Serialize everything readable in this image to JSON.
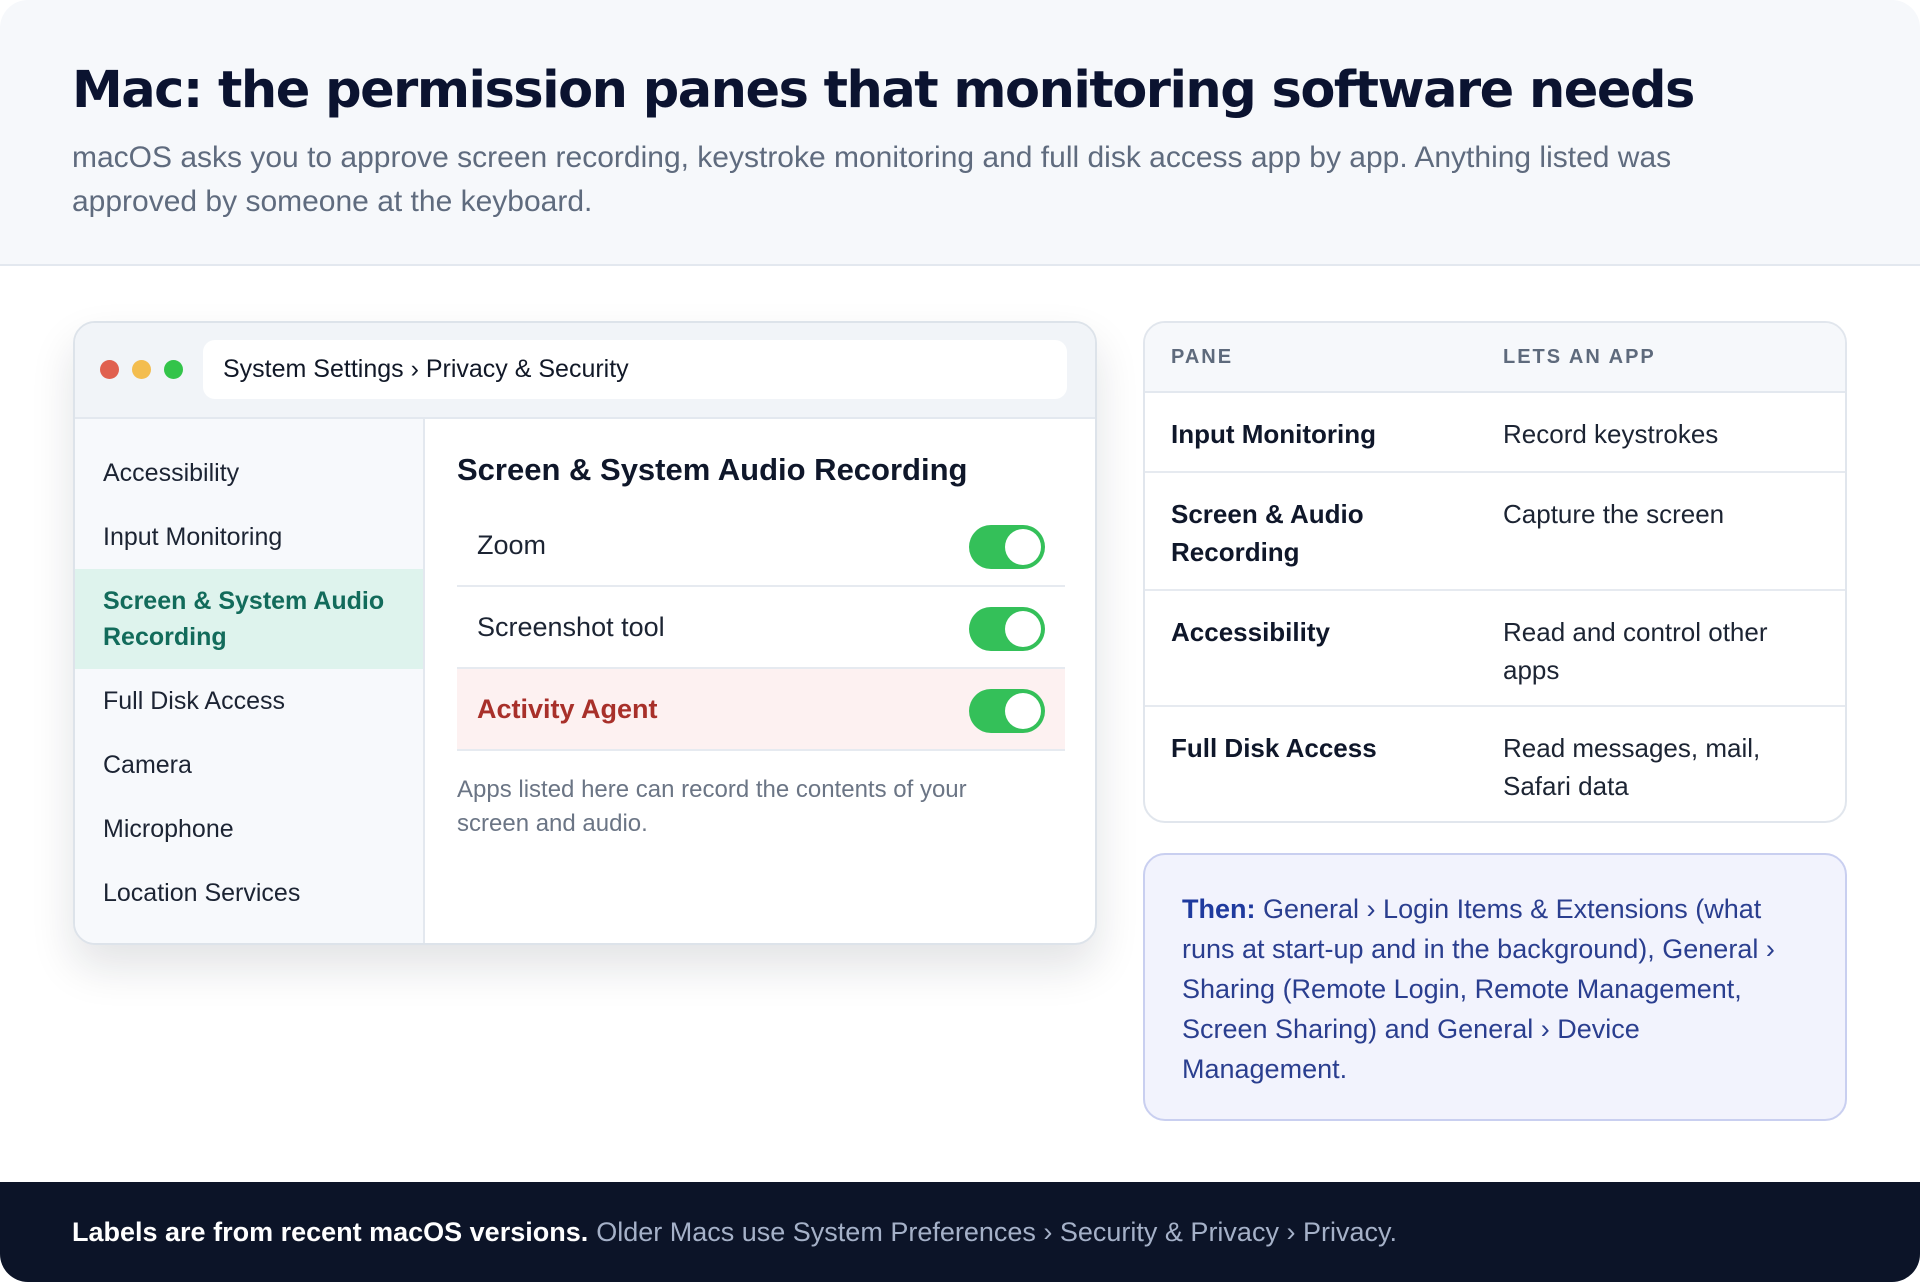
{
  "header": {
    "title": "Mac: the permission panes that monitoring software needs",
    "subtitle": "macOS asks you to approve screen recording, keystroke monitoring and full disk access app by app. Anything listed was approved by someone at the keyboard."
  },
  "window": {
    "address": "System Settings › Privacy & Security",
    "sidebar": {
      "items": [
        {
          "label": "Accessibility"
        },
        {
          "label": "Input Monitoring"
        },
        {
          "label": "Screen & System Audio Recording",
          "selected": true
        },
        {
          "label": "Full Disk Access"
        },
        {
          "label": "Camera"
        },
        {
          "label": "Microphone"
        },
        {
          "label": "Location Services"
        }
      ]
    },
    "pane": {
      "title": "Screen & System Audio Recording",
      "apps": [
        {
          "name": "Zoom",
          "enabled": true
        },
        {
          "name": "Screenshot tool",
          "enabled": true
        },
        {
          "name": "Activity Agent",
          "enabled": true,
          "highlighted": true
        }
      ],
      "note": "Apps listed here can record the contents of your screen and audio."
    }
  },
  "table": {
    "headers": {
      "pane": "PANE",
      "lets": "LETS AN APP"
    },
    "rows": [
      {
        "pane": "Input Monitoring",
        "lets": "Record keystrokes"
      },
      {
        "pane": "Screen & Audio Recording",
        "lets": "Capture the screen"
      },
      {
        "pane": "Accessibility",
        "lets": "Read and control other apps"
      },
      {
        "pane": "Full Disk Access",
        "lets": "Read messages, mail, Safari data"
      }
    ]
  },
  "callout": {
    "lead": "Then:",
    "text": "General › Login Items & Extensions (what runs at start-up and in the background), General › Sharing (Remote Login, Remote Management, Screen Sharing) and General › Device Management."
  },
  "footer": {
    "lead": "Labels are from recent macOS versions.",
    "text": "Older Macs use System Preferences › Security & Privacy › Privacy."
  },
  "colors": {
    "toggle_on": "#34c059",
    "selected_sidebar_bg": "#def3ed",
    "selected_sidebar_text": "#126b5b",
    "flagged_row_bg": "#fdf1f1",
    "flagged_row_text": "#a8302a",
    "callout_bg": "#f2f3fd",
    "footer_bg": "#0c1428"
  }
}
